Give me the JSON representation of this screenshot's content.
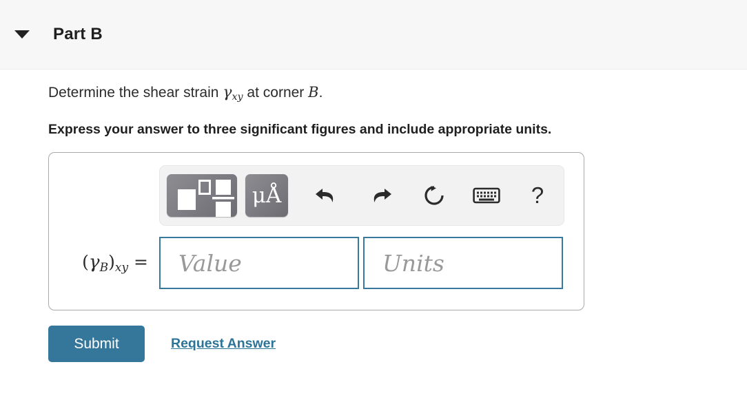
{
  "header": {
    "caret_icon": "chevron-down-icon",
    "title": "Part B"
  },
  "question": {
    "prefix": "Determine the shear strain ",
    "symbol_gamma": "γ",
    "symbol_gamma_sub": "xy",
    "middle": " at corner ",
    "corner": "B",
    "suffix": ".",
    "instruction": "Express your answer to three significant figures and include appropriate units."
  },
  "toolbar": {
    "template_button": {
      "name": "math-template-button",
      "label": ""
    },
    "units_button": {
      "name": "units-button",
      "label": "μÅ"
    },
    "icons": [
      {
        "name": "undo-icon",
        "label": "undo"
      },
      {
        "name": "redo-icon",
        "label": "redo"
      },
      {
        "name": "reset-icon",
        "label": "reset"
      },
      {
        "name": "keyboard-icon",
        "label": "keyboard"
      },
      {
        "name": "help-icon",
        "label": "?"
      }
    ]
  },
  "answer": {
    "label_open": "(",
    "label_gamma": "γ",
    "label_gamma_sub": "B",
    "label_close": ")",
    "label_sub": "xy",
    "label_equals": "=",
    "value_field": {
      "value": "",
      "placeholder": "Value"
    },
    "units_field": {
      "value": "",
      "placeholder": "Units"
    }
  },
  "actions": {
    "submit_label": "Submit",
    "request_answer_label": "Request Answer"
  },
  "colors": {
    "accent": "#35779b",
    "link": "#2b7498",
    "field_border": "#37789c",
    "header_bg": "#f7f7f7",
    "toolbar_bg": "#f2f2f2",
    "button_gray": "#7e7e84",
    "placeholder": "#999999"
  }
}
